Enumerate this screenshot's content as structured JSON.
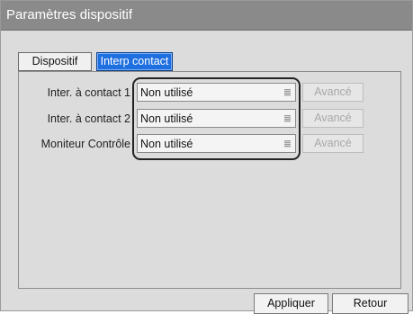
{
  "window": {
    "title": "Paramètres dispositif"
  },
  "tabs": [
    {
      "label": "Dispositif",
      "active": false
    },
    {
      "label": "Interp contact",
      "active": true
    }
  ],
  "rows": [
    {
      "label": "Inter. à contact 1",
      "value": "Non utilisé",
      "advanced_label": "Avancé",
      "advanced_enabled": false
    },
    {
      "label": "Inter. à contact 2",
      "value": "Non utilisé",
      "advanced_label": "Avancé",
      "advanced_enabled": false
    },
    {
      "label": "Moniteur Contrôle",
      "value": "Non utilisé",
      "advanced_label": "Avancé",
      "advanced_enabled": false
    }
  ],
  "footer": {
    "apply_label": "Appliquer",
    "back_label": "Retour"
  },
  "colors": {
    "titlebar": "#8a8a8a",
    "active_tab": "#1e6fe0",
    "background": "#dcdcdc"
  },
  "icons": {
    "dropdown": "dropdown-arrow-icon"
  }
}
